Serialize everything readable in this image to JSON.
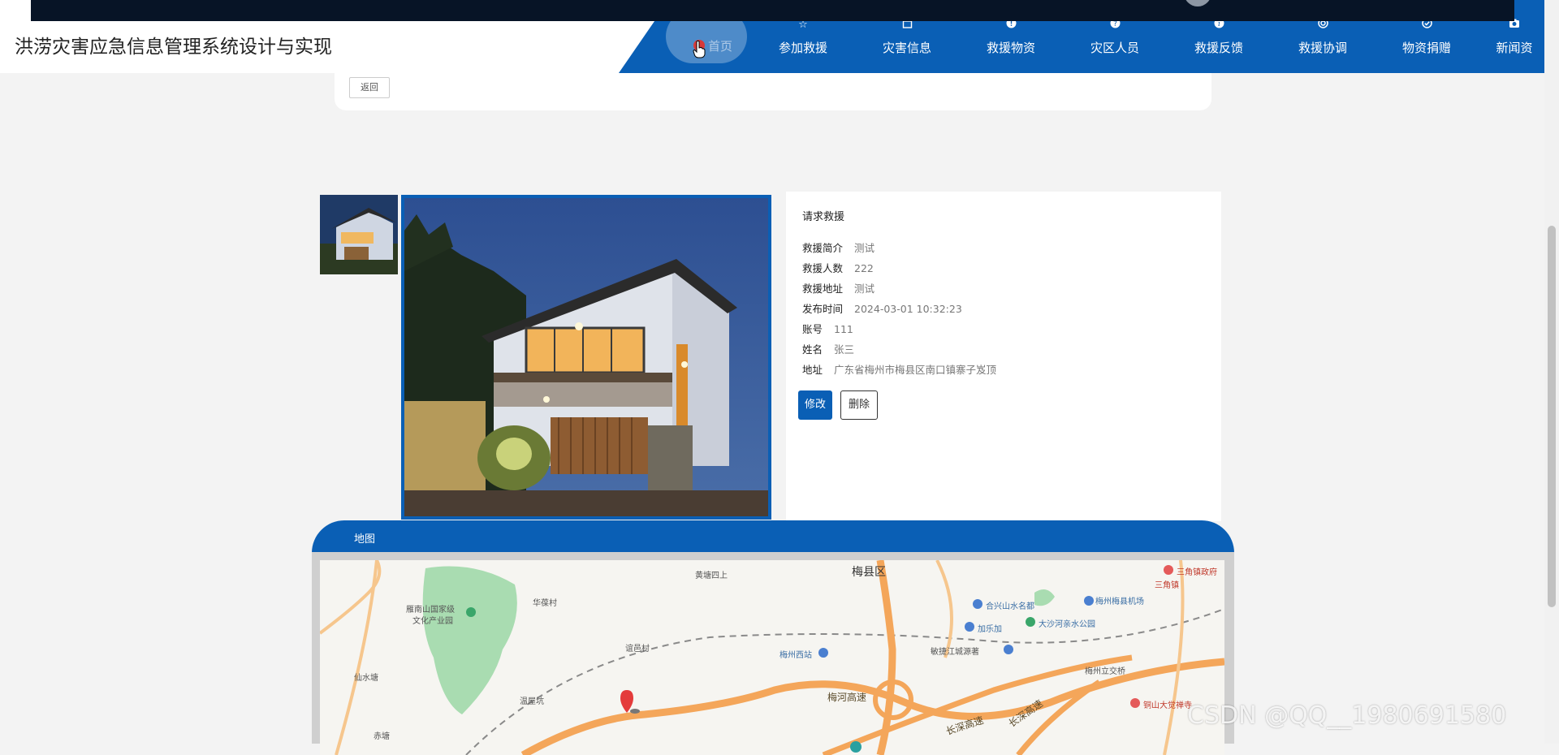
{
  "header": {
    "site_title": "洪涝灾害应急信息管理系统设计与实现",
    "nav": [
      {
        "label": "参加救援",
        "icon": "star-icon"
      },
      {
        "label": "灾害信息",
        "icon": "bag-icon"
      },
      {
        "label": "救援物资",
        "icon": "alert-icon"
      },
      {
        "label": "灾区人员",
        "icon": "question-icon"
      },
      {
        "label": "救援反馈",
        "icon": "info-icon"
      },
      {
        "label": "救援协调",
        "icon": "lifebuoy-icon"
      },
      {
        "label": "物资捐赠",
        "icon": "check-circle-icon"
      },
      {
        "label": "新闻资",
        "icon": "camera-icon"
      }
    ],
    "home_label": "首页"
  },
  "back": {
    "label": "返回"
  },
  "detail": {
    "title": "请求救援",
    "rows": [
      {
        "key": "救援简介",
        "value": "测试"
      },
      {
        "key": "救援人数",
        "value": "222"
      },
      {
        "key": "救援地址",
        "value": "测试"
      },
      {
        "key": "发布时间",
        "value": "2024-03-01 10:32:23"
      },
      {
        "key": "账号",
        "value": "111"
      },
      {
        "key": "姓名",
        "value": "张三"
      },
      {
        "key": "地址",
        "value": "广东省梅州市梅县区南口镇寨子岌顶"
      }
    ],
    "edit_label": "修改",
    "delete_label": "删除"
  },
  "map": {
    "title": "地图",
    "labels": {
      "meixian": "梅县区",
      "sanjiao": "三角镇政府",
      "sanjiao2": "三角镇",
      "airport": "梅州梅县机场",
      "huangtang": "黄塘四上",
      "huachao": "华葆村",
      "yanmen": "雁南山国家级",
      "yanmen2": "文化产业园",
      "hexing": "合兴山水名都",
      "jiale": "加乐加",
      "dashahe": "大沙河亲水公园",
      "meizhouxi": "梅州西站",
      "jiangcheng": "敏捷江城源著",
      "meihe": "梅河高速",
      "changshen": "长深高速",
      "changshen2": "长深高速",
      "lijiao": "梅州立交桥",
      "xianshuitang": "仙水塘",
      "wenwu": "温屋坑",
      "chitang": "赤塘",
      "yiyingcun": "谊邑村",
      "tongshan": "铜山大觉禅寺"
    }
  },
  "watermark": "CSDN @QQ__1980691580"
}
